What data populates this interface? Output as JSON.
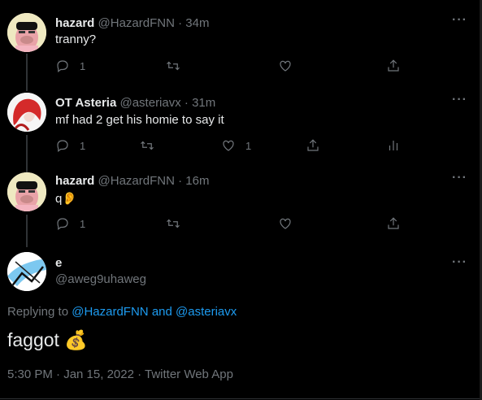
{
  "tweets": [
    {
      "name": "hazard",
      "handle": "@HazardFNN",
      "sep": "·",
      "time": "34m",
      "text": "tranny?",
      "reply_count": "1",
      "retweet_count": "",
      "like_count": ""
    },
    {
      "name": "OT Asteria",
      "handle": "@asteriavx",
      "sep": "·",
      "time": "31m",
      "text": "mf had 2 get his homie to say it",
      "reply_count": "1",
      "retweet_count": "",
      "like_count": "1"
    },
    {
      "name": "hazard",
      "handle": "@HazardFNN",
      "sep": "·",
      "time": "16m",
      "text": "q👂",
      "reply_count": "1",
      "retweet_count": "",
      "like_count": ""
    }
  ],
  "main_tweet": {
    "name": "e",
    "handle": "@aweg9uhaweg",
    "replying_prefix": "Replying to",
    "replying_user1": "@HazardFNN",
    "replying_and": "and",
    "replying_user2": "@asteriavx",
    "text": "faggot 💰",
    "timestamp": "5:30 PM · Jan 15, 2022 · Twitter Web App"
  },
  "more_label": "···",
  "colors": {
    "background": "#000000",
    "link": "#1d9bf0",
    "muted": "#71767b"
  }
}
